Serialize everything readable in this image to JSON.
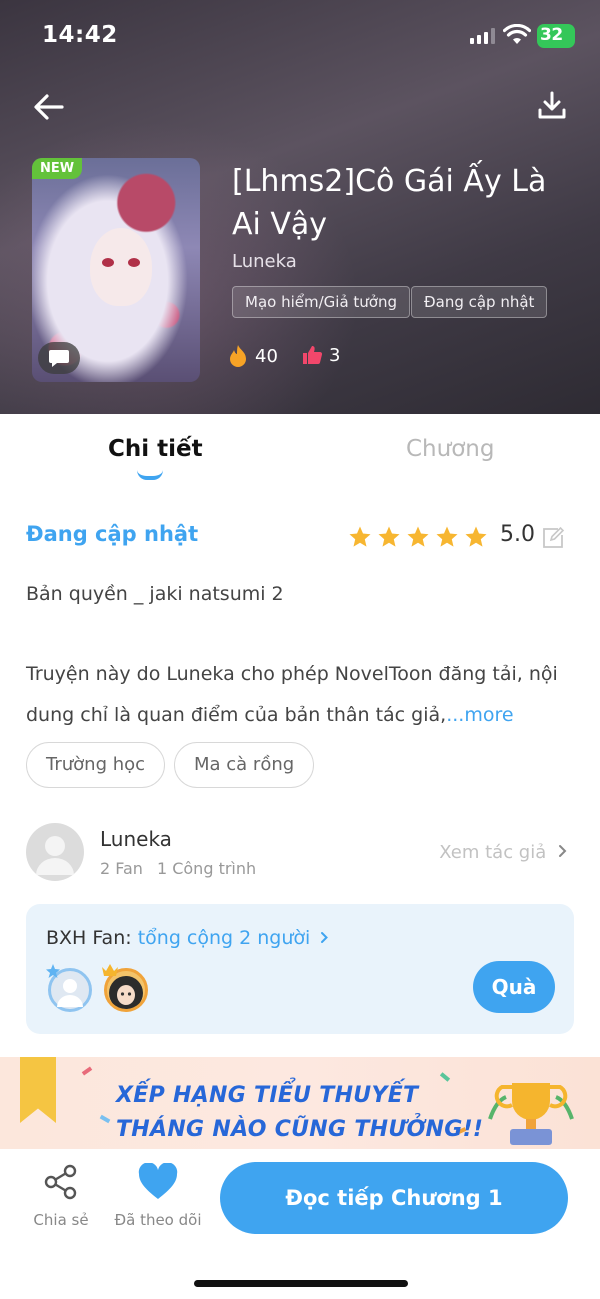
{
  "status_bar": {
    "time": "14:42",
    "battery": "32"
  },
  "book": {
    "title": "[Lhms2]Cô Gái Ấy Là Ai Vậy",
    "author": "Luneka",
    "new_badge": "NEW",
    "tags": [
      "Mạo hiểm/Giả tưởng",
      "Đang cập nhật"
    ],
    "hot_count": "40",
    "likes_count": "3"
  },
  "tabs": [
    "Chi tiết",
    "Chương"
  ],
  "details": {
    "status": "Đang cập nhật",
    "rating": "5.0",
    "stars": 5,
    "copyright": "Bản quyền _ jaki natsumi 2",
    "description": "Truyện này do Luneka cho phép NovelToon đăng tải, nội dung chỉ là quan điểm của bản thân tác giả,",
    "more_label": "...more",
    "genres": [
      "Trường học",
      "Ma cà rồng"
    ]
  },
  "author_card": {
    "name": "Luneka",
    "fans": "2 Fan",
    "works": "1 Công trình",
    "link_label": "Xem tác giả"
  },
  "fan_ranking": {
    "label": "BXH Fan: ",
    "link": "tổng cộng 2 người",
    "gift_label": "Quà"
  },
  "banner": {
    "line1": "XẾP HẠNG TIỂU THUYẾT",
    "line2": "THÁNG NÀO CŨNG THƯỞNG!!"
  },
  "bottom_bar": {
    "share_label": "Chia sẻ",
    "follow_label": "Đã theo dõi",
    "read_label": "Đọc tiếp Chương 1"
  },
  "colors": {
    "accent": "#3fa4f0",
    "star": "#f7b631",
    "new_badge": "#63c23a",
    "battery": "#34c759"
  },
  "icons": [
    "back-icon",
    "download-icon",
    "fire-icon",
    "thumbs-up-icon",
    "star-icon",
    "edit-icon",
    "share-icon",
    "heart-icon",
    "chevron-right-icon"
  ]
}
